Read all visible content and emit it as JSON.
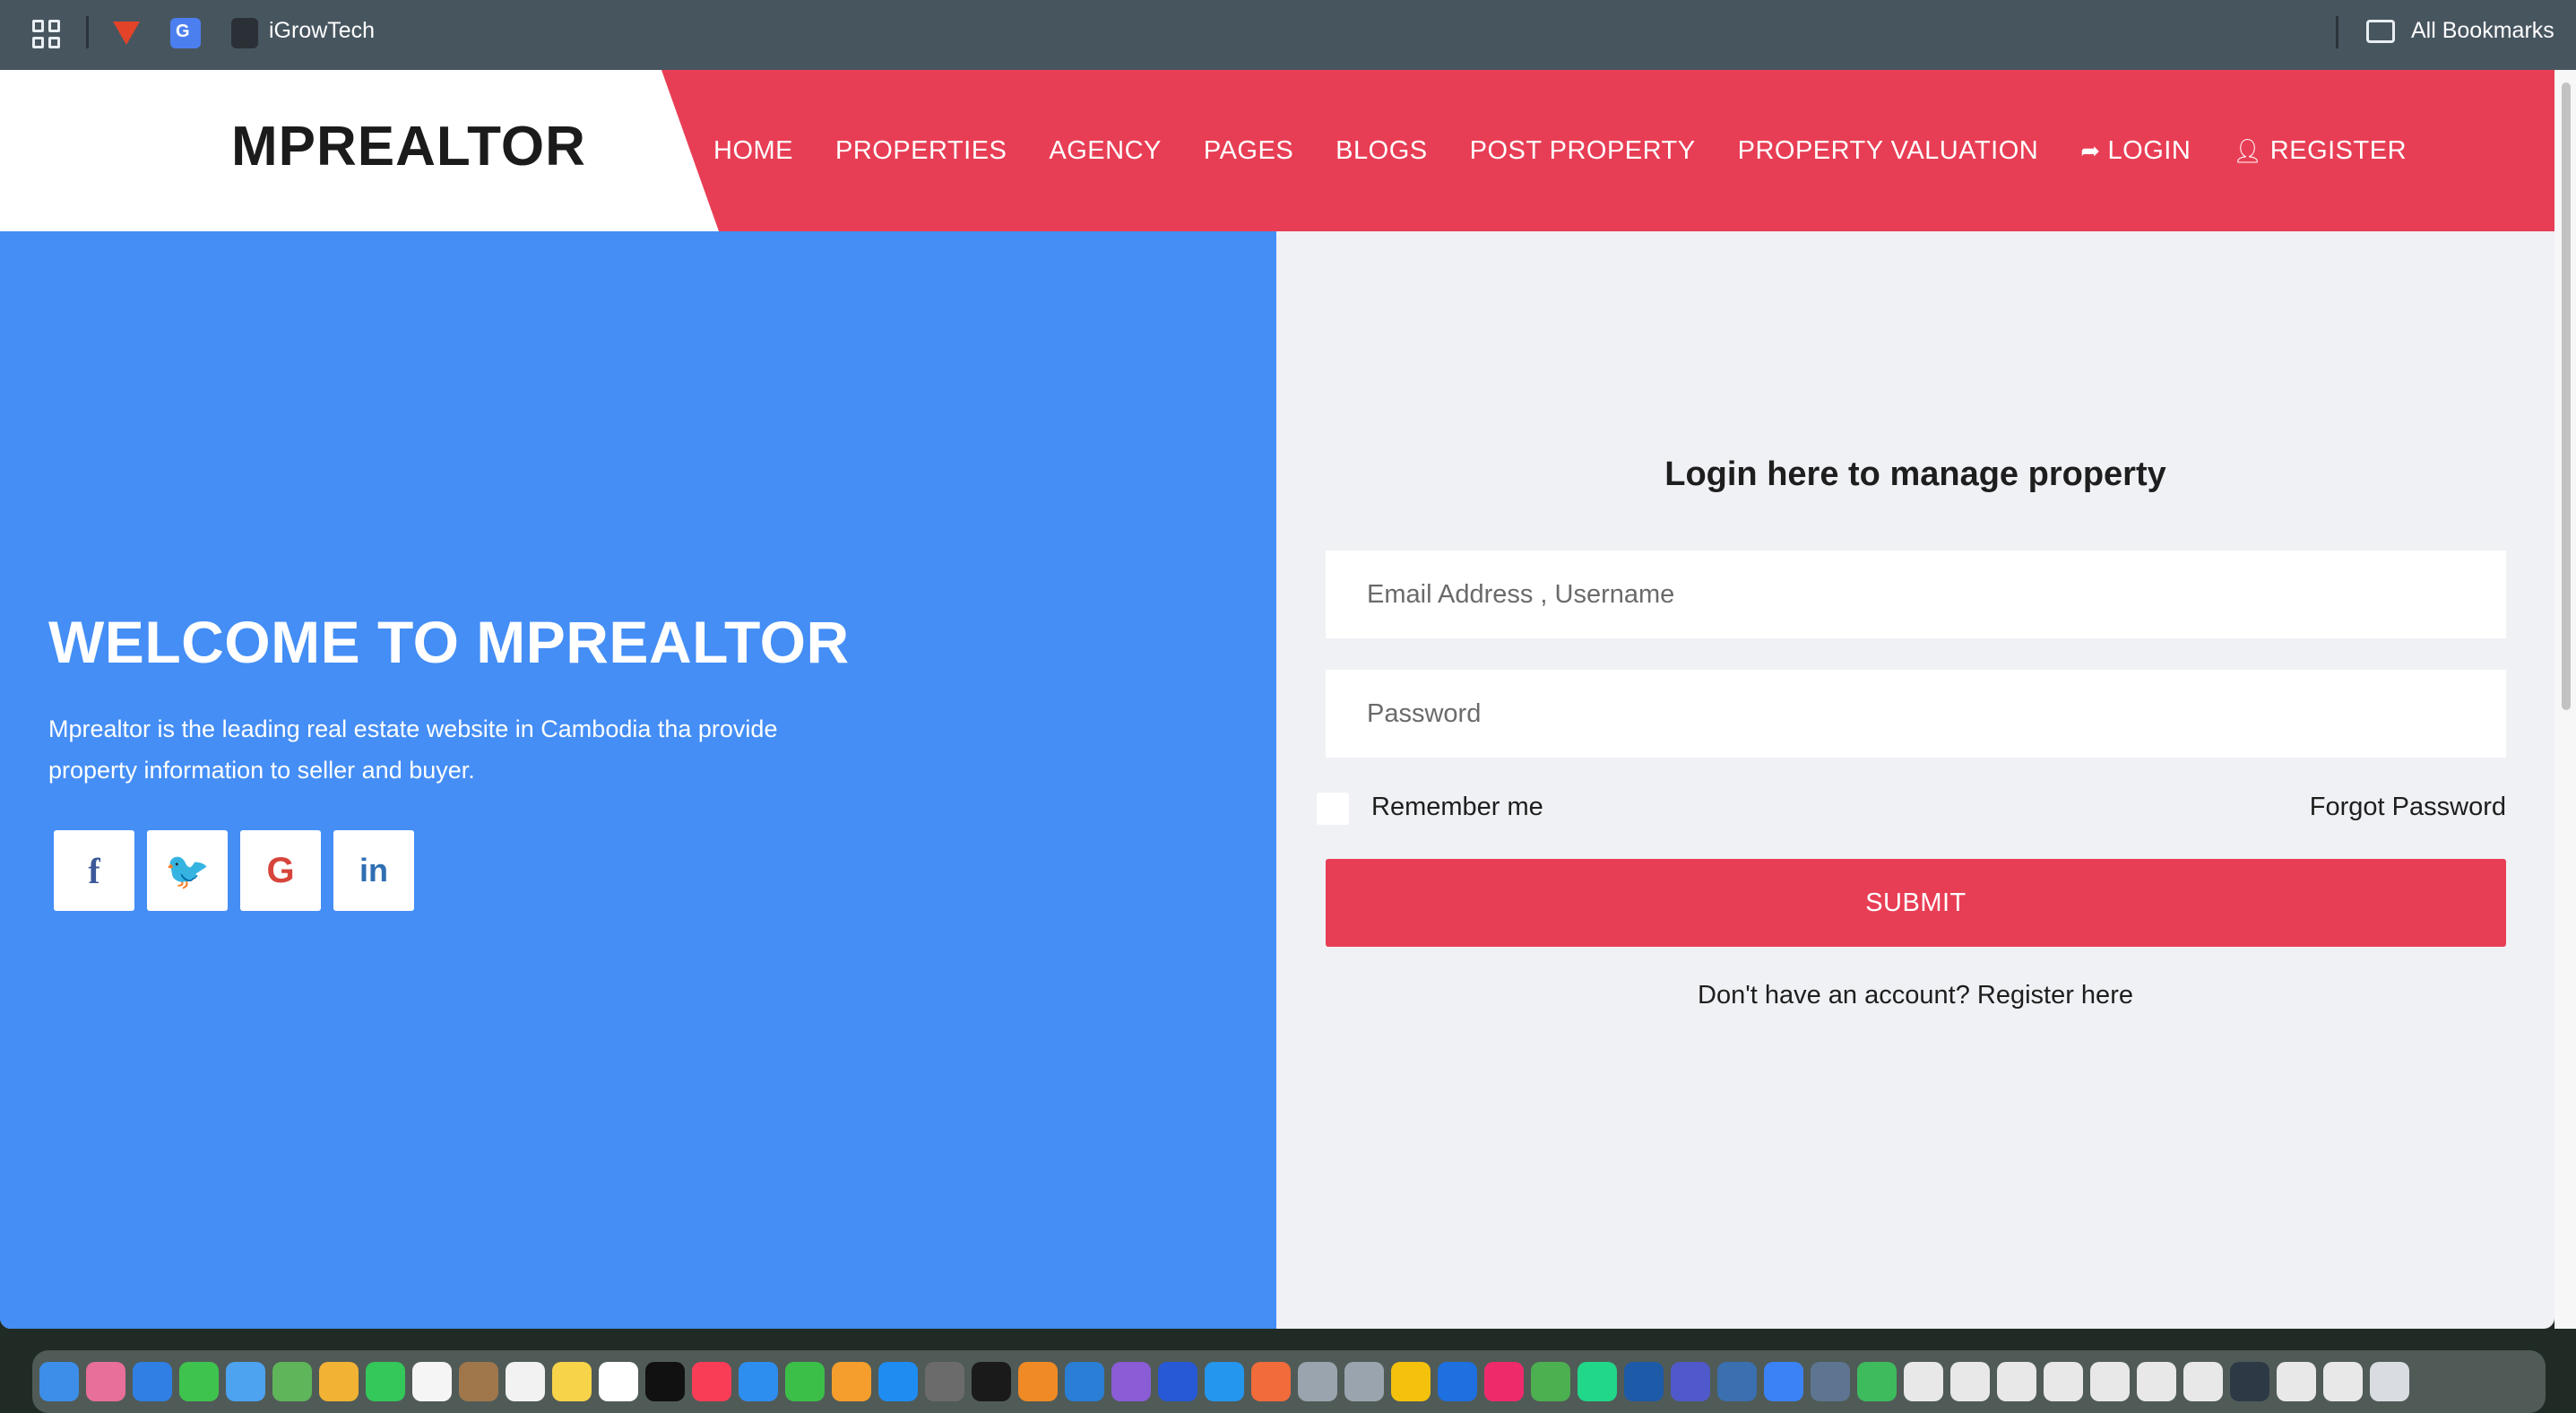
{
  "bookmarks_bar": {
    "items": [
      {
        "icon": "gitlab-icon",
        "label": ""
      },
      {
        "icon": "google-translate-icon",
        "label": ""
      },
      {
        "icon": "igrowtech-icon",
        "label": "iGrowTech"
      }
    ],
    "all_bookmarks_label": "All Bookmarks"
  },
  "site": {
    "logo": "MPREALTOR",
    "nav": [
      {
        "label": "HOME",
        "icon": ""
      },
      {
        "label": "PROPERTIES",
        "icon": ""
      },
      {
        "label": "AGENCY",
        "icon": ""
      },
      {
        "label": "PAGES",
        "icon": ""
      },
      {
        "label": "BLOGS",
        "icon": ""
      },
      {
        "label": "POST PROPERTY",
        "icon": ""
      },
      {
        "label": "PROPERTY VALUATION",
        "icon": ""
      },
      {
        "label": "LOGIN",
        "icon": "sign-in-icon"
      },
      {
        "label": "REGISTER",
        "icon": "user-icon"
      }
    ],
    "colors": {
      "accent": "#e83e55",
      "hero": "#448ef5",
      "form_bg": "#f0f1f5"
    }
  },
  "hero": {
    "title": "WELCOME TO MPREALTOR",
    "description": "Mprealtor is the leading real estate website in Cambodia tha provide property information to seller and buyer.",
    "social": [
      {
        "icon": "facebook-icon",
        "glyph": "f"
      },
      {
        "icon": "twitter-icon",
        "glyph": "🐦"
      },
      {
        "icon": "google-icon",
        "glyph": "G"
      },
      {
        "icon": "linkedin-icon",
        "glyph": "in"
      }
    ]
  },
  "login_form": {
    "title": "Login here to manage property",
    "email_placeholder": "Email Address , Username",
    "password_placeholder": "Password",
    "remember_label": "Remember me",
    "forgot_label": "Forgot Password",
    "submit_label": "SUBMIT",
    "register_prompt": "Don't have an account?",
    "register_link": "Register here"
  }
}
